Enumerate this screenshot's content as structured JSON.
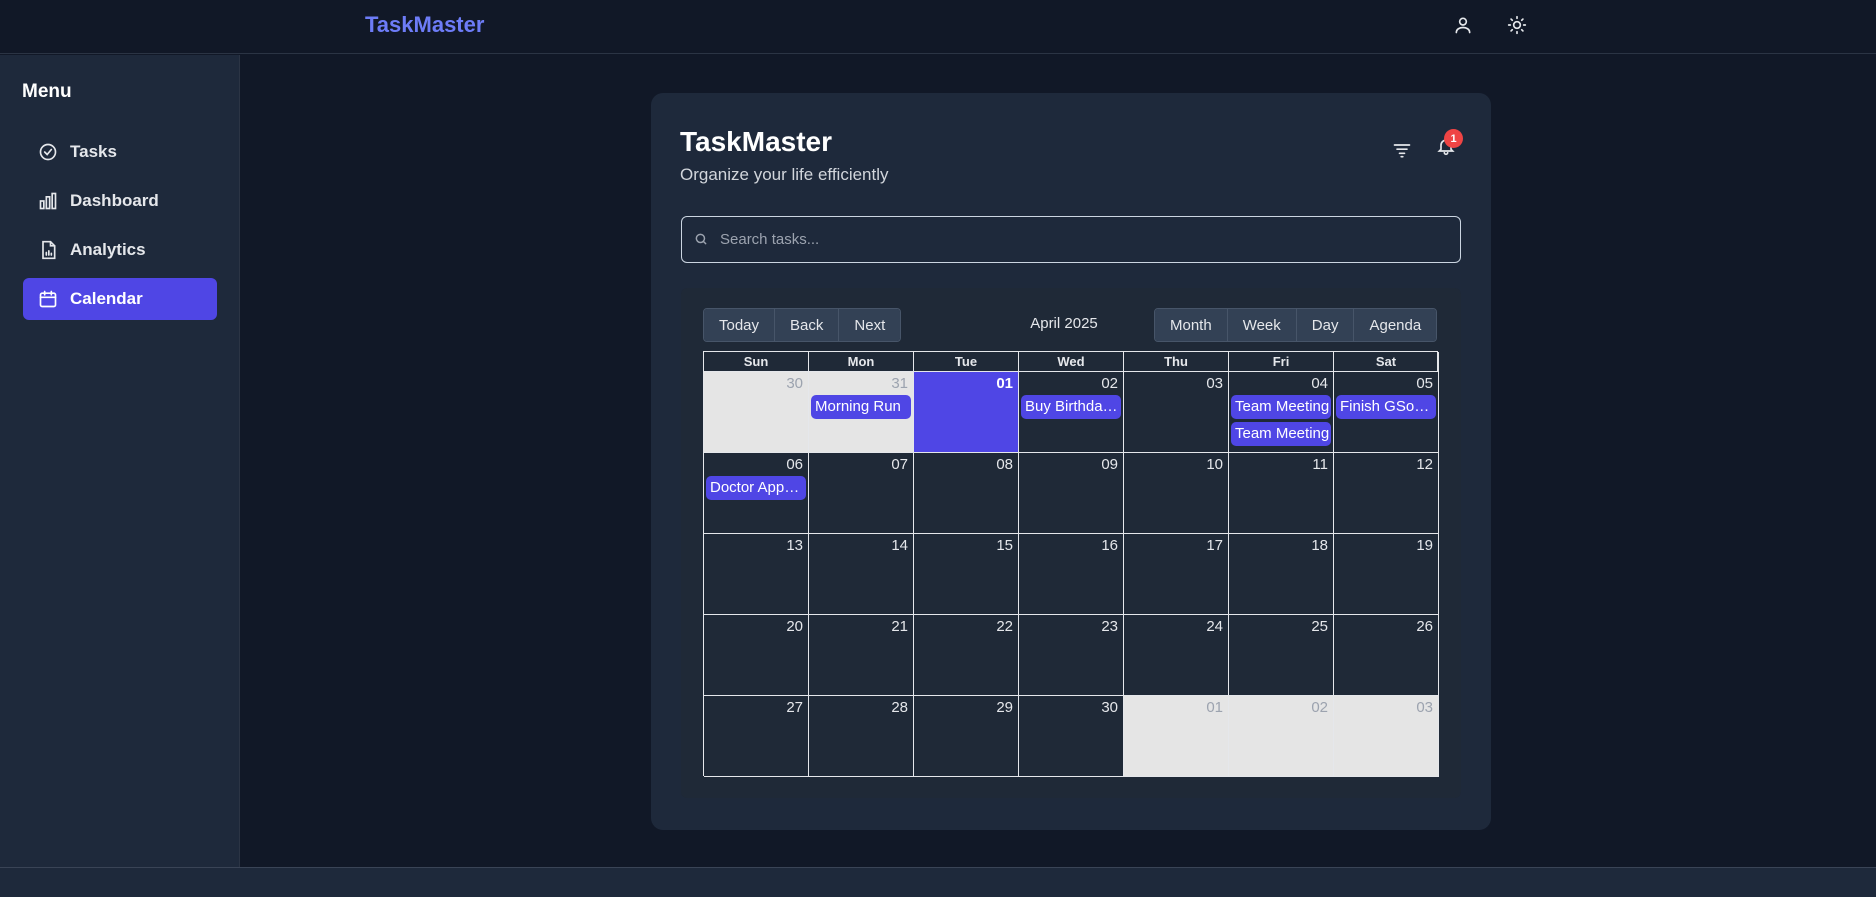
{
  "header": {
    "brand": "TaskMaster"
  },
  "sidebar": {
    "title": "Menu",
    "items": [
      {
        "label": "Tasks",
        "icon": "check-circle-icon"
      },
      {
        "label": "Dashboard",
        "icon": "bar-chart-icon"
      },
      {
        "label": "Analytics",
        "icon": "file-chart-icon"
      },
      {
        "label": "Calendar",
        "icon": "calendar-icon",
        "active": true
      }
    ]
  },
  "card": {
    "title": "TaskMaster",
    "subtitle": "Organize your life efficiently",
    "notification_count": "1"
  },
  "search": {
    "placeholder": "Search tasks..."
  },
  "calendar": {
    "nav_buttons": [
      "Today",
      "Back",
      "Next"
    ],
    "label": "April 2025",
    "view_buttons": [
      "Month",
      "Week",
      "Day",
      "Agenda"
    ],
    "weekdays": [
      "Sun",
      "Mon",
      "Tue",
      "Wed",
      "Thu",
      "Fri",
      "Sat"
    ],
    "weeks": [
      [
        {
          "day": "30",
          "off": true
        },
        {
          "day": "31",
          "off": true,
          "events": [
            "Morning Run"
          ]
        },
        {
          "day": "01",
          "today": true
        },
        {
          "day": "02",
          "events": [
            "Buy Birthday Gift"
          ]
        },
        {
          "day": "03"
        },
        {
          "day": "04",
          "events": [
            "Team Meeting",
            "Team Meeting"
          ]
        },
        {
          "day": "05",
          "events": [
            "Finish GSoC Proposal"
          ]
        }
      ],
      [
        {
          "day": "06",
          "events": [
            "Doctor Appointment"
          ]
        },
        {
          "day": "07"
        },
        {
          "day": "08"
        },
        {
          "day": "09"
        },
        {
          "day": "10"
        },
        {
          "day": "11"
        },
        {
          "day": "12"
        }
      ],
      [
        {
          "day": "13"
        },
        {
          "day": "14"
        },
        {
          "day": "15"
        },
        {
          "day": "16"
        },
        {
          "day": "17"
        },
        {
          "day": "18"
        },
        {
          "day": "19"
        }
      ],
      [
        {
          "day": "20"
        },
        {
          "day": "21"
        },
        {
          "day": "22"
        },
        {
          "day": "23"
        },
        {
          "day": "24"
        },
        {
          "day": "25"
        },
        {
          "day": "26"
        }
      ],
      [
        {
          "day": "27"
        },
        {
          "day": "28"
        },
        {
          "day": "29"
        },
        {
          "day": "30"
        },
        {
          "day": "01",
          "off": true
        },
        {
          "day": "02",
          "off": true
        },
        {
          "day": "03",
          "off": true
        }
      ]
    ]
  },
  "colors": {
    "accent": "#4f46e5",
    "brand": "#6d7cf7",
    "background": "#111827",
    "panel": "#1e293b"
  }
}
